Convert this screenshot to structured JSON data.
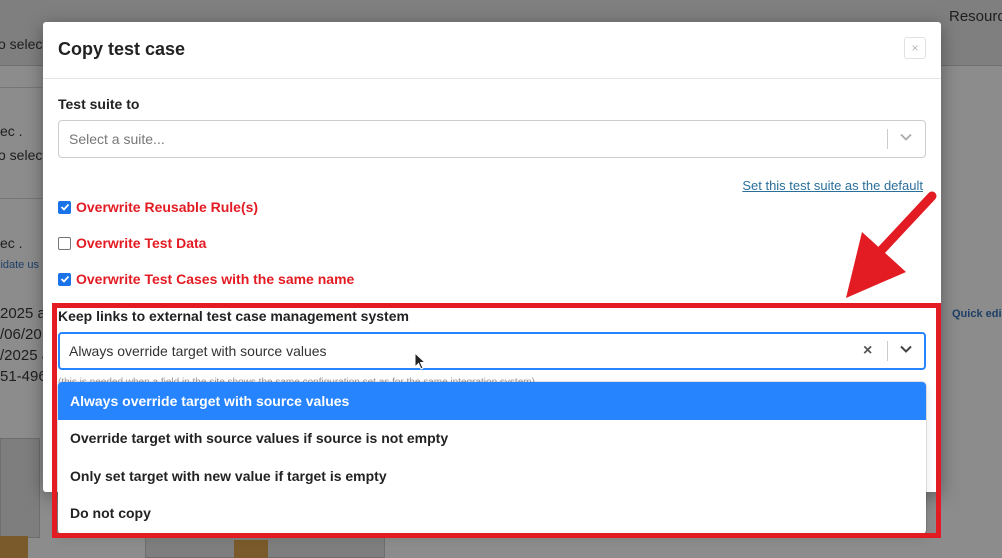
{
  "background": {
    "header_right_text": "Resourc",
    "fragments": [
      {
        "text": "o select",
        "name": "bg-fragment-select-1"
      },
      {
        "text": "ec .",
        "name": "bg-fragment-ec-1"
      },
      {
        "text": "o select",
        "name": "bg-fragment-select-2"
      },
      {
        "text": "ec .",
        "name": "bg-fragment-ec-2"
      },
      {
        "text": "2025 at",
        "name": "bg-fragment-date-1"
      },
      {
        "text": "/06/20",
        "name": "bg-fragment-date-2"
      },
      {
        "text": "/2025 a",
        "name": "bg-fragment-date-3"
      },
      {
        "text": "51-496",
        "name": "bg-fragment-id"
      }
    ],
    "validate_link": "lidate us",
    "quick_edit_link": "Quick edi"
  },
  "modal": {
    "title": "Copy test case",
    "close_label": "×",
    "suite_label": "Test suite to",
    "suite_placeholder": "Select a suite...",
    "default_link": "Set this test suite as the default",
    "checkboxes": [
      {
        "label": "Overwrite Reusable Rule(s)",
        "checked": true
      },
      {
        "label": "Overwrite Test Data",
        "checked": false
      },
      {
        "label": "Overwrite Test Cases with the same name",
        "checked": true
      }
    ],
    "links_label": "Keep links to external test case management system",
    "links_value": "Always override target with source values",
    "links_clear": "×",
    "hint_text": "(this is needed when a field in the site shows the same configuration set as for the same integration system)",
    "options": [
      {
        "label": "Always override target with source values",
        "selected": true
      },
      {
        "label": "Override target with source values if source is not empty",
        "selected": false
      },
      {
        "label": "Only set target with new value if target is empty",
        "selected": false
      },
      {
        "label": "Do not copy",
        "selected": false
      }
    ]
  },
  "icons": {
    "chevron": "chevron-down-icon",
    "check": "check-icon",
    "cursor": "mouse-pointer-icon",
    "arrow": "red-arrow-annotation"
  },
  "colors": {
    "accent": "#2684ff",
    "annotation_red": "#e31b23",
    "warning_text": "#e31b23"
  }
}
